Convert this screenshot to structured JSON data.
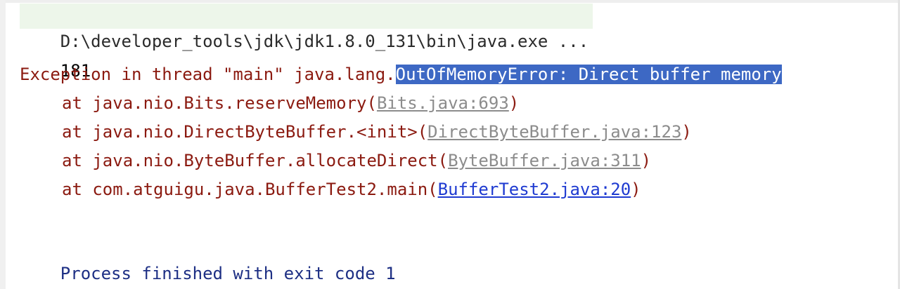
{
  "console": {
    "command_line": "D:\\developer_tools\\jdk\\jdk1.8.0_131\\bin\\java.exe ...",
    "output_line": "181",
    "exception": {
      "prefix": "Exception in thread \"main\" java.lang.",
      "selected_text": "OutOfMemoryError: Direct buffer memory"
    },
    "stack_trace": [
      {
        "at": "at java.nio.Bits.reserveMemory(",
        "link": "Bits.java:693",
        "suffix": ")"
      },
      {
        "at": "at java.nio.DirectByteBuffer.<init>(",
        "link": "DirectByteBuffer.java:123",
        "suffix": ")"
      },
      {
        "at": "at java.nio.ByteBuffer.allocateDirect(",
        "link": "ByteBuffer.java:311",
        "suffix": ")"
      },
      {
        "at": "at com.atguigu.java.BufferTest2.main(",
        "link": "BufferTest2.java:20",
        "suffix": ")"
      }
    ],
    "finish_line": "Process finished with exit code 1"
  },
  "colors": {
    "error_text": "#8b1a10",
    "selection_bg": "#3d68c4",
    "library_link": "#8c8c8c",
    "user_link": "#1f3bd1",
    "process_finished": "#1d2f84",
    "command_bg": "#edf6ea"
  }
}
